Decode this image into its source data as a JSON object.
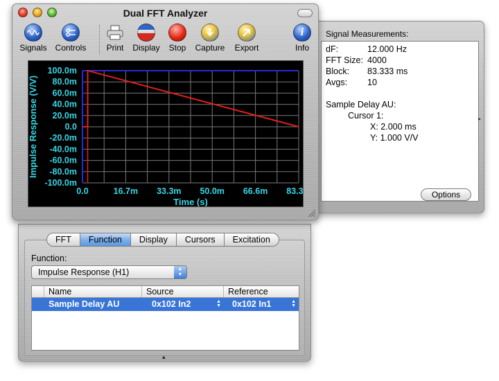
{
  "window": {
    "title": "Dual FFT Analyzer"
  },
  "toolbar": {
    "items": [
      {
        "label": "Signals",
        "icon": "signals-icon"
      },
      {
        "label": "Controls",
        "icon": "controls-icon"
      },
      {
        "label": "Print",
        "icon": "printer-icon"
      },
      {
        "label": "Display",
        "icon": "display-icon"
      },
      {
        "label": "Stop",
        "icon": "stop-icon"
      },
      {
        "label": "Capture",
        "icon": "capture-icon"
      },
      {
        "label": "Export",
        "icon": "export-icon"
      },
      {
        "label": "Info",
        "icon": "info-icon"
      }
    ]
  },
  "chart_data": {
    "type": "line",
    "xlabel": "Time (s)",
    "ylabel": "Impulse Response (V/V)",
    "x_tick_labels": [
      "0.0",
      "16.7m",
      "33.3m",
      "50.0m",
      "66.6m",
      "83.3m"
    ],
    "y_tick_labels": [
      "100.0m",
      "80.0m",
      "60.0m",
      "40.0m",
      "20.0m",
      "0.0",
      "-20.0m",
      "-40.0m",
      "-60.0m",
      "-80.0m",
      "-100.0m"
    ],
    "xlim": [
      0,
      0.0833
    ],
    "ylim": [
      -0.1,
      0.1
    ],
    "grid": true,
    "series": [
      {
        "color": "#e0201a",
        "x": [
          0,
          0.002,
          0.002,
          0.0833
        ],
        "y": [
          0,
          0,
          1.0,
          0
        ]
      }
    ],
    "cursor": {
      "x": 0.002,
      "color": "#e0201a"
    },
    "colors": {
      "background": "#000000",
      "grid": "#7a7a7a",
      "axis": "#2b2bd6",
      "labels": "#37d6e6"
    }
  },
  "measurements": {
    "title": "Signal Measurements:",
    "rows": [
      {
        "key": "dF:",
        "value": "12.000 Hz"
      },
      {
        "key": "FFT Size:",
        "value": "4000"
      },
      {
        "key": "Block:",
        "value": "83.333 ms"
      },
      {
        "key": "Avgs:",
        "value": "10"
      }
    ],
    "channel": "Sample Delay AU:",
    "cursor_label": "Cursor 1:",
    "cursor_x": "X: 2.000 ms",
    "cursor_y": "Y: 1.000 V/V",
    "options_label": "Options"
  },
  "tabs": [
    {
      "label": "FFT",
      "active": false
    },
    {
      "label": "Function",
      "active": true
    },
    {
      "label": "Display",
      "active": false
    },
    {
      "label": "Cursors",
      "active": false
    },
    {
      "label": "Excitation",
      "active": false
    }
  ],
  "function": {
    "label": "Function:",
    "selected": "Impulse Response (H1)"
  },
  "table": {
    "headers": [
      "Name",
      "Source",
      "Reference"
    ],
    "rows": [
      {
        "name": "Sample Delay AU",
        "source": "0x102 In2",
        "reference": "0x102 In1",
        "selected": true
      }
    ]
  }
}
